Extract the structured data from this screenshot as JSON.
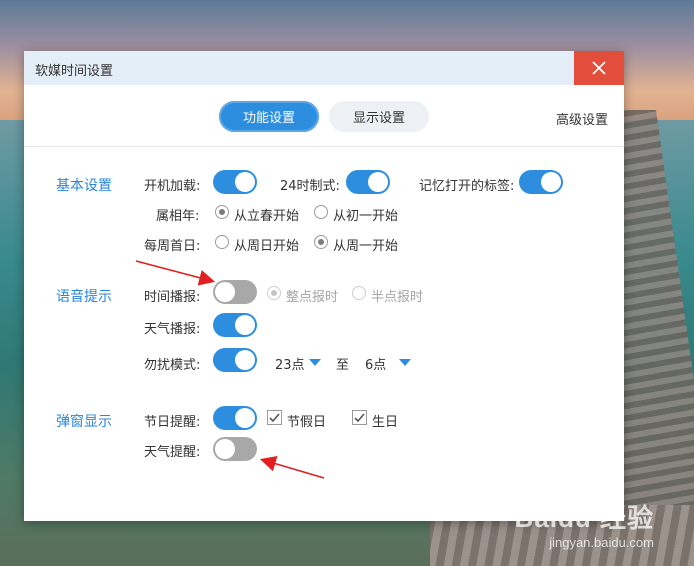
{
  "window": {
    "title": "软媒时间设置"
  },
  "tabs": [
    {
      "label": "功能设置",
      "active": true
    },
    {
      "label": "显示设置",
      "active": false
    },
    {
      "label": "高级设置",
      "active": false
    }
  ],
  "basic": {
    "section_title": "基本设置",
    "boot_load_label": "开机加载:",
    "boot_load_on": true,
    "h24_label": "24时制式:",
    "h24_on": true,
    "remember_tabs_label": "记忆打开的标签:",
    "remember_tabs_on": true,
    "zodiac_year_label": "属相年:",
    "zodiac_options": [
      "从立春开始",
      "从初一开始"
    ],
    "zodiac_selected": "从立春开始",
    "week_start_label": "每周首日:",
    "week_options": [
      "从周日开始",
      "从周一开始"
    ],
    "week_selected": "从周一开始"
  },
  "voice": {
    "section_title": "语音提示",
    "time_announce_label": "时间播报:",
    "time_announce_on": false,
    "time_options": [
      "整点报时",
      "半点报时"
    ],
    "time_selected": "整点报时",
    "weather_announce_label": "天气播报:",
    "weather_announce_on": true,
    "dnd_label": "勿扰模式:",
    "dnd_on": true,
    "dnd_from": "23点",
    "dnd_to_label": "至",
    "dnd_to": "6点"
  },
  "popup": {
    "section_title": "弹窗显示",
    "holiday_reminder_label": "节日提醒:",
    "holiday_reminder_on": true,
    "holiday_checkbox_label": "节假日",
    "holiday_checked": true,
    "birthday_checkbox_label": "生日",
    "birthday_checked": true,
    "weather_reminder_label": "天气提醒:",
    "weather_reminder_on": false
  },
  "watermark": {
    "logo": "Baidu 经验",
    "url": "jingyan.baidu.com"
  },
  "colors": {
    "accent": "#2d8ee0",
    "close": "#e34d3b",
    "titlebar": "#e4eef8",
    "annotation_arrow": "#e02020"
  }
}
